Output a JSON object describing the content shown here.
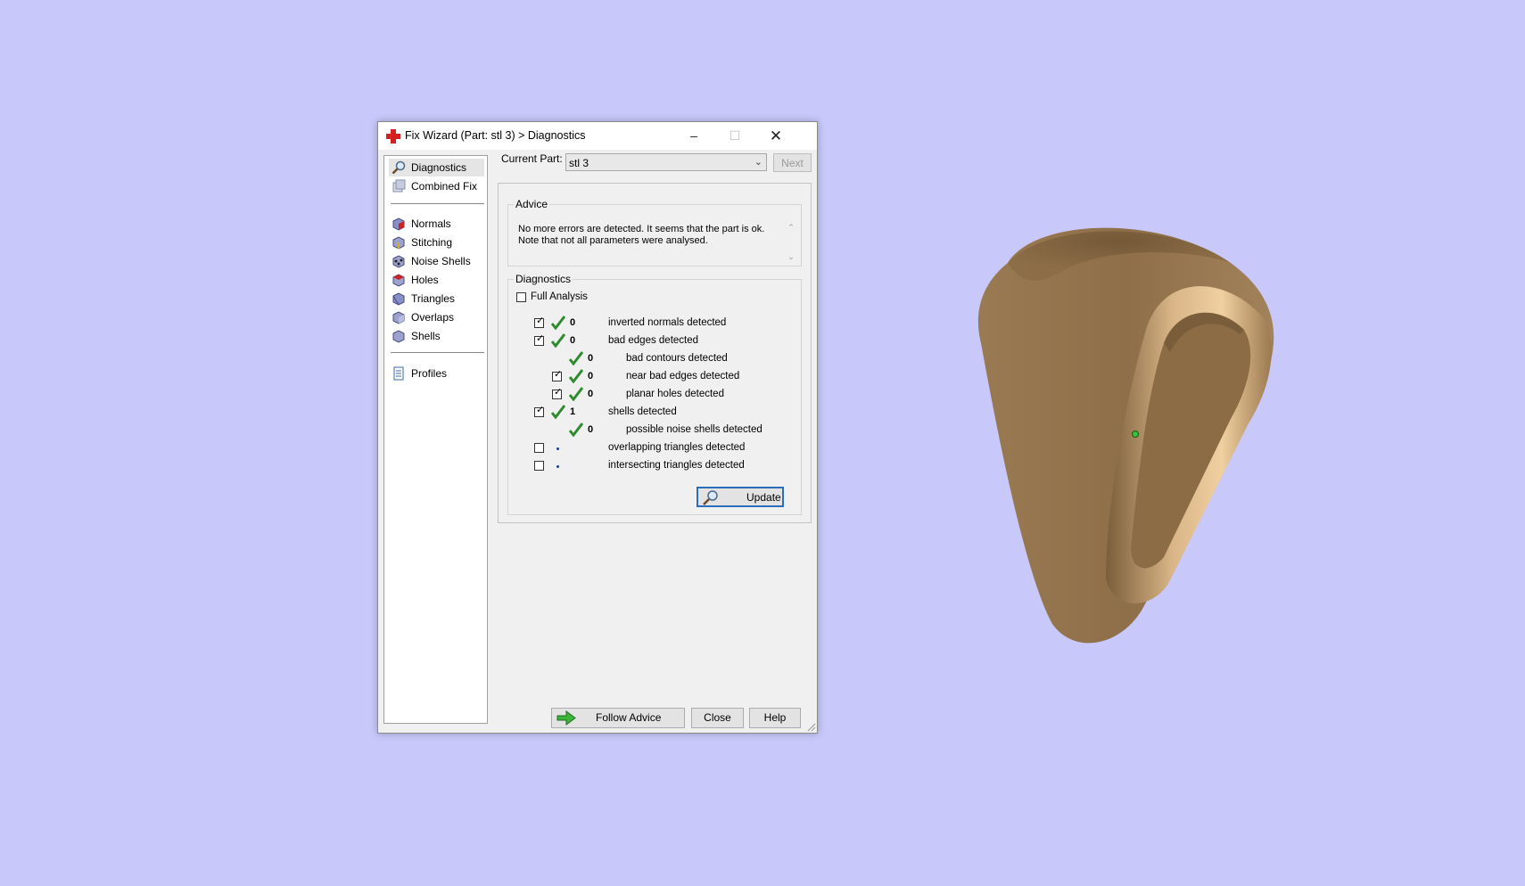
{
  "window": {
    "title": "Fix Wizard (Part: stl 3) > Diagnostics",
    "minimize": "–",
    "maximize": "☐",
    "close": "✕"
  },
  "nav": {
    "items": [
      {
        "label": "Diagnostics",
        "icon": "magnifier-icon"
      },
      {
        "label": "Combined Fix",
        "icon": "combined-fix-icon"
      },
      {
        "label": "Normals",
        "icon": "normals-cube-icon"
      },
      {
        "label": "Stitching",
        "icon": "stitching-cube-icon"
      },
      {
        "label": "Noise Shells",
        "icon": "noise-shells-icon"
      },
      {
        "label": "Holes",
        "icon": "holes-cube-icon"
      },
      {
        "label": "Triangles",
        "icon": "triangles-cube-icon"
      },
      {
        "label": "Overlaps",
        "icon": "overlaps-cube-icon"
      },
      {
        "label": "Shells",
        "icon": "shells-cube-icon"
      },
      {
        "label": "Profiles",
        "icon": "document-icon"
      }
    ]
  },
  "current_part": {
    "label": "Current Part:",
    "value": "stl 3",
    "next_label": "Next"
  },
  "advice": {
    "title": "Advice",
    "text_line1": "No more errors are detected. It seems that the part is ok.",
    "text_line2": "Note that not all parameters were analysed."
  },
  "diagnostics": {
    "title": "Diagnostics",
    "full_analysis_label": "Full Analysis",
    "rows": [
      {
        "checked": true,
        "status": "ok",
        "count": "0",
        "label": "inverted normals detected"
      },
      {
        "checked": true,
        "status": "ok",
        "count": "0",
        "label": "bad edges detected"
      },
      {
        "checked": null,
        "status": "ok",
        "count": "0",
        "label": "bad contours detected"
      },
      {
        "checked": true,
        "status": "ok",
        "count": "0",
        "label": "near bad edges detected"
      },
      {
        "checked": true,
        "status": "ok",
        "count": "0",
        "label": "planar holes detected"
      },
      {
        "checked": true,
        "status": "ok",
        "count": "1",
        "label": "shells detected"
      },
      {
        "checked": null,
        "status": "ok",
        "count": "0",
        "label": "possible noise shells detected"
      },
      {
        "checked": false,
        "status": "not-run",
        "count": "",
        "label": "overlapping triangles detected"
      },
      {
        "checked": false,
        "status": "not-run",
        "count": "",
        "label": "intersecting triangles detected"
      }
    ],
    "update_label": "Update"
  },
  "footer": {
    "follow_advice": "Follow Advice",
    "close": "Close",
    "help": "Help"
  },
  "colors": {
    "viewport_bg": "#c8c8fa",
    "part_color": "#b08a5e",
    "check_green": "#2e8b2e",
    "accent_blue": "#2a6ebb"
  }
}
